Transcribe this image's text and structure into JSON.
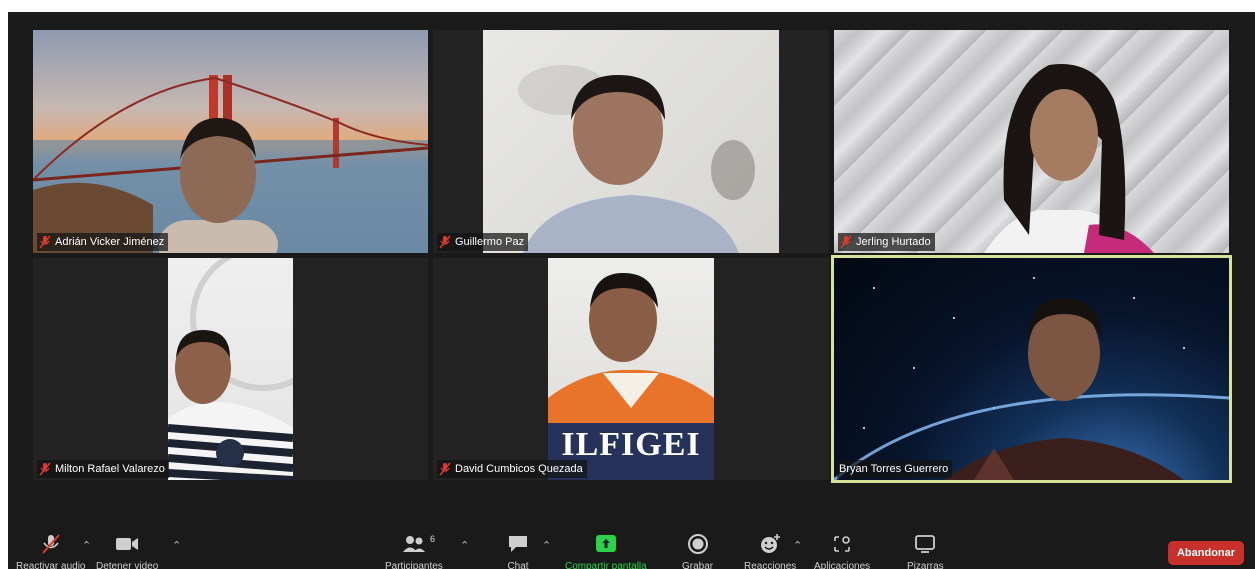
{
  "participants": [
    {
      "name": "Adrián Vicker Jiménez",
      "muted": true
    },
    {
      "name": "Guillermo Paz",
      "muted": true
    },
    {
      "name": "Jerling Hurtado",
      "muted": true
    },
    {
      "name": "Milton Rafael Valarezo",
      "muted": true
    },
    {
      "name": "David Cumbicos Quezada",
      "muted": true
    },
    {
      "name": "Bryan Torres Guerrero",
      "muted": false,
      "active_speaker": true
    }
  ],
  "toolbar": {
    "audio_label": "Reactivar audio",
    "video_label": "Detener video",
    "participants_label": "Participantes",
    "participants_count": "6",
    "chat_label": "Chat",
    "share_label": "Compartir pantalla",
    "record_label": "Grabar",
    "reactions_label": "Reacciones",
    "apps_label": "Aplicaciones",
    "whiteboards_label": "Pizarras",
    "leave_label": "Abandonar",
    "share_color": "#2dd24b",
    "leave_color": "#c8302c"
  },
  "shirt_text": "ILFIGEI",
  "colors": {
    "background": "#1a1a1a",
    "active_border": "#d7e39a",
    "muted_icon": "#e0392b"
  }
}
